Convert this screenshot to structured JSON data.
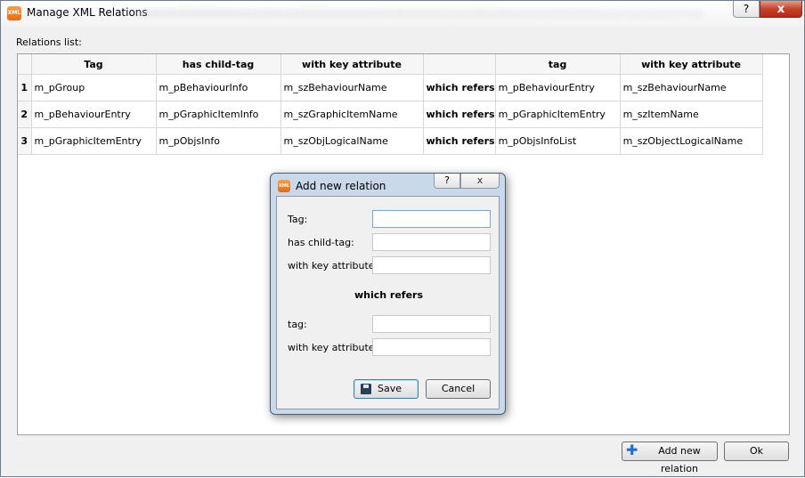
{
  "window": {
    "title": "Manage XML Relations",
    "app_icon_text": "XML",
    "help_label": "?",
    "close_label": "x"
  },
  "relations": {
    "label": "Relations list:",
    "columns": [
      "Tag",
      "has child-tag",
      "with key attribute",
      "",
      "tag",
      "with key attribute"
    ],
    "rows": [
      {
        "num": "1",
        "cells": [
          "m_pGroup",
          "m_pBehaviourInfo",
          "m_szBehaviourName",
          "which refers",
          "m_pBehaviourEntry",
          "m_szBehaviourName"
        ]
      },
      {
        "num": "2",
        "cells": [
          "m_pBehaviourEntry",
          "m_pGraphicItemInfo",
          "m_szGraphicItemName",
          "which refers",
          "m_pGraphicItemEntry",
          "m_szItemName"
        ]
      },
      {
        "num": "3",
        "cells": [
          "m_pGraphicItemEntry",
          "m_pObjsInfo",
          "m_szObjLogicalName",
          "which refers",
          "m_pObjsInfoList",
          "m_szObjectLogicalName"
        ]
      }
    ]
  },
  "footer": {
    "add_label": "Add new relation",
    "ok_label": "Ok"
  },
  "dialog": {
    "title": "Add new relation",
    "icon_text": "XML",
    "help_label": "?",
    "close_label": "x",
    "fields": {
      "tag_label": "Tag:",
      "child_label": "has child-tag:",
      "key_label": "with key attribute:",
      "section": "which refers",
      "ref_tag_label": "tag:",
      "ref_key_label": "with key attribute:"
    },
    "save_label": "Save",
    "cancel_label": "Cancel"
  }
}
